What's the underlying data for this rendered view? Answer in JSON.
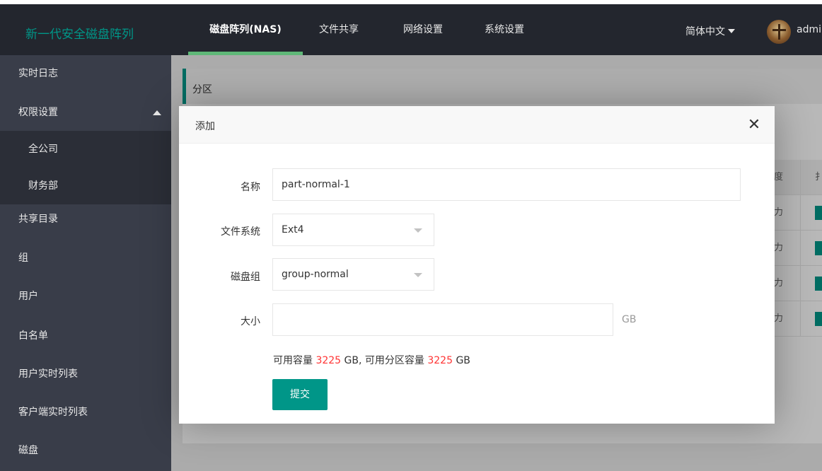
{
  "header": {
    "logo": "新一代安全磁盘阵列",
    "nav": [
      "磁盘阵列(NAS)",
      "文件共享",
      "网络设置",
      "系统设置"
    ],
    "active_nav": "磁盘阵列(NAS)",
    "language": "简体中文",
    "user": "admin",
    "user_visible": "adı"
  },
  "sidebar": {
    "items": [
      {
        "label": "实时日志"
      },
      {
        "label": "权限设置"
      },
      {
        "label": "全公司"
      },
      {
        "label": "财务部"
      },
      {
        "label": "共享目录"
      },
      {
        "label": "组"
      },
      {
        "label": "用户"
      },
      {
        "label": "白名单"
      },
      {
        "label": "用户实时列表"
      },
      {
        "label": "客户端实时列表"
      },
      {
        "label": "磁盘"
      }
    ]
  },
  "panel": {
    "title": "分区",
    "table_partial": {
      "header_col": "度",
      "header_col2": "扌",
      "rows": [
        "力",
        "力",
        "力",
        "力"
      ]
    }
  },
  "modal": {
    "title": "添加",
    "close_symbol": "✕",
    "fields": {
      "name_label": "名称",
      "name_value": "part-normal-1",
      "fs_label": "文件系统",
      "fs_value": "Ext4",
      "group_label": "磁盘组",
      "group_value": "group-normal",
      "size_label": "大小",
      "size_value": "",
      "size_unit": "GB"
    },
    "capacity": {
      "prefix": "可用容量",
      "available": "3225",
      "mid": "GB, 可用分区容量",
      "partition_available": "3225",
      "suffix": "GB"
    },
    "submit_label": "提交"
  },
  "colors": {
    "accent": "#009688",
    "topbar": "#23262e",
    "sidebar": "#393d49",
    "highlight_red": "#ff3333"
  }
}
